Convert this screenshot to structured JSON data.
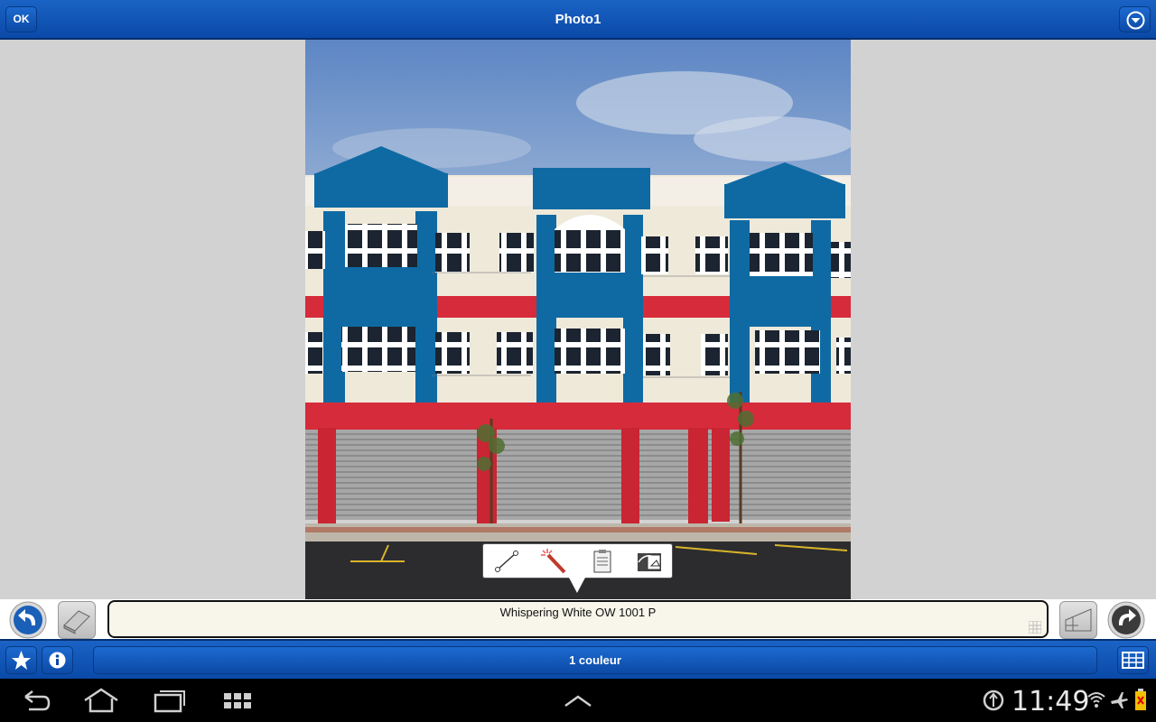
{
  "header": {
    "ok_label": "OK",
    "title": "Photo1"
  },
  "editor": {
    "selected_color": "Whispering White OW 1001 P",
    "color_count": "1 couleur"
  },
  "tools": [
    "line-tool-icon",
    "magic-wand-icon",
    "clipboard-icon",
    "paint-bucket-icon"
  ],
  "status_bar": {
    "time": "11:49"
  },
  "colors": {
    "brand_blue": "#0a49a8",
    "wall_blue": "#0f6aa3",
    "accent_red": "#d62b3a",
    "color_field_bg": "#f8f6ea"
  }
}
